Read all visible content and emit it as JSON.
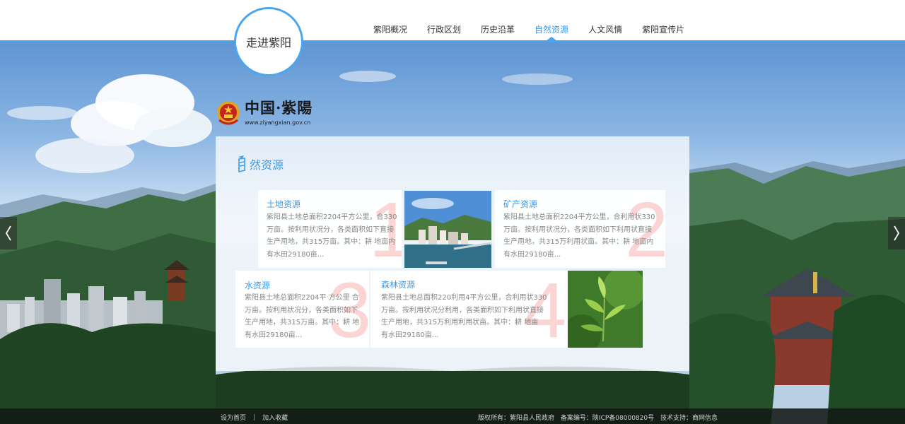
{
  "header": {
    "logo_text": "走进紫阳",
    "nav": [
      {
        "label": "紫阳概况",
        "active": false
      },
      {
        "label": "行政区划",
        "active": false
      },
      {
        "label": "历史沿革",
        "active": false
      },
      {
        "label": "自然资源",
        "active": true
      },
      {
        "label": "人文风情",
        "active": false
      },
      {
        "label": "紫阳宣传片",
        "active": false
      }
    ]
  },
  "brand": {
    "name": "中国·紫陽",
    "url": "www.ziyangxian.gov.cn"
  },
  "panel": {
    "title": "然资源",
    "title_icon": "feather-quill-icon",
    "cards": [
      {
        "number": "1",
        "title": "土地资源",
        "desc": [
          "紫阳县土地总面积2204平方公里，合330",
          "万亩。按利用状况分，各类面积如下直接",
          "生产用地，共315万亩。其中：耕 地亩内",
          "有水田29180亩..."
        ]
      },
      {
        "number": "2",
        "title": "矿产资源",
        "desc": [
          "紫阳县土地总面积2204平方公里，合利用状330",
          "万亩。按利用状况分，各类面积如下利用状直接",
          "生产用地，共315万利用状亩。其中：耕 地亩内",
          "有水田29180亩..."
        ]
      },
      {
        "number": "3",
        "title": "水资源",
        "desc": [
          "紫阳县土地总面积2204平 方公里 合",
          "万亩。按利用状况分，各类面积如下",
          "生产用地，共315万亩。其中：耕 地",
          "有水田29180亩..."
        ]
      },
      {
        "number": "4",
        "title": "森林资源",
        "desc": [
          "紫阳县土地总面积220利用4平方公里，合利用状330",
          "万亩。按利用状况分利用，各类面积如下利用状直接",
          "生产用地，共315万利用利用状亩。其中：耕 地亩",
          "有水田29180亩..."
        ]
      }
    ]
  },
  "footer": {
    "set_home": "设为首页",
    "separator": "|",
    "add_fav": "加入收藏",
    "copyright_label": "版权所有：",
    "copyright_value": "紫阳县人民政府",
    "icp_label": "备案编号：",
    "icp_value": "陕ICP备08000820号",
    "support_label": "技术支持：",
    "support_value": "商网信息"
  },
  "icons": {
    "left_arrow": "chevron-left-icon",
    "right_arrow": "chevron-right-icon",
    "emblem": "national-emblem-icon"
  },
  "colors": {
    "accent": "#4aa6ef",
    "nav_active": "#3d9ae8",
    "card_number": "#f8b0b0"
  }
}
